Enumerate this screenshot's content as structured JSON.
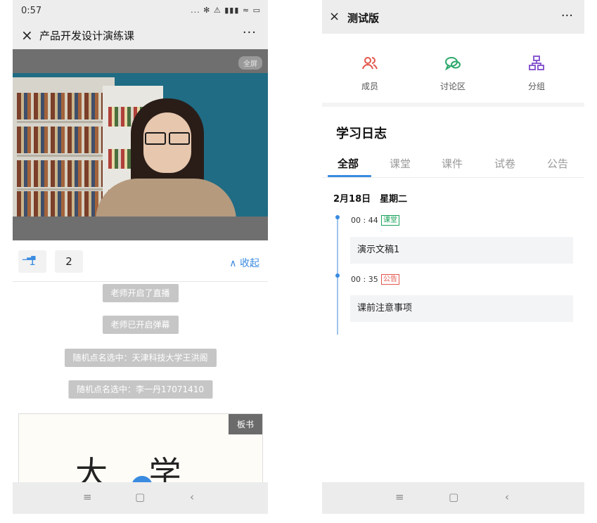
{
  "left": {
    "status": {
      "time": "0:57",
      "icons": "... ✻ ⚠ ▮▮▮ ≈ ▭"
    },
    "title": {
      "close": "×",
      "text": "产品开发设计演练课",
      "more": "···"
    },
    "video": {
      "fullscreen": "全屏"
    },
    "tabs": {
      "tab1": "1",
      "tab2": "2",
      "collapse": "∧ 收起"
    },
    "messages": [
      "老师开启了直播",
      "老师已开启弹幕",
      "随机点名选中：天津科技大学王洪阁",
      "随机点名选中：李一丹17071410"
    ],
    "board": {
      "label": "板书",
      "handwriting": "大 学 机"
    },
    "nav": {
      "menu": "≡",
      "home": "▢",
      "back": "‹"
    }
  },
  "right": {
    "title": {
      "close": "×",
      "text": "测试版",
      "more": "···"
    },
    "features": [
      {
        "icon": "members-icon",
        "label": "成员",
        "color": "#e2574c"
      },
      {
        "icon": "discussion-icon",
        "label": "讨论区",
        "color": "#2aa86a"
      },
      {
        "icon": "group-icon",
        "label": "分组",
        "color": "#8a5ad0"
      }
    ],
    "journal": {
      "title": "学习日志",
      "tabs": [
        "全部",
        "课堂",
        "课件",
        "试卷",
        "公告"
      ],
      "active_tab": "全部",
      "date": "2月18日　星期二",
      "entries": [
        {
          "time": "00 : 44",
          "tag": "课堂",
          "tag_color": "#1aa35b",
          "content": "演示文稿1"
        },
        {
          "time": "00 : 35",
          "tag": "公告",
          "tag_color": "#e2574c",
          "content": "课前注意事项"
        }
      ]
    },
    "nav": {
      "menu": "≡",
      "home": "▢",
      "back": "‹"
    }
  },
  "accent": "#3a8be0"
}
